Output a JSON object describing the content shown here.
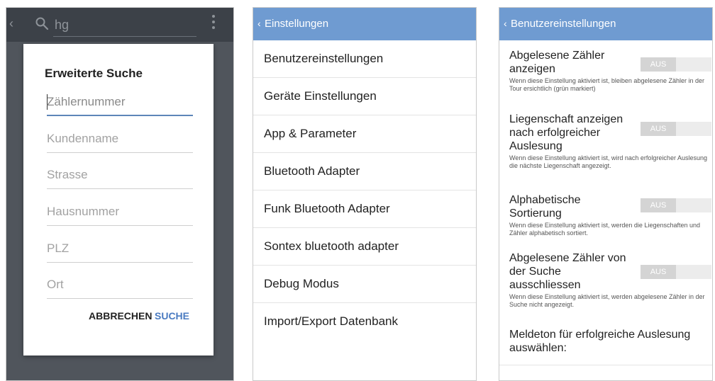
{
  "screen1": {
    "back_icon": "back-chevron-icon",
    "search_icon": "search-icon",
    "search_query": "hg",
    "overflow_icon": "overflow-menu-icon",
    "dialog": {
      "title": "Erweiterte Suche",
      "fields": [
        {
          "placeholder": "Zählernummer",
          "active": true
        },
        {
          "placeholder": "Kundenname"
        },
        {
          "placeholder": "Strasse"
        },
        {
          "placeholder": "Hausnummer"
        },
        {
          "placeholder": "PLZ"
        },
        {
          "placeholder": "Ort"
        }
      ],
      "cancel_label": "ABBRECHEN",
      "search_label": "SUCHE"
    }
  },
  "screen2": {
    "title": "Einstellungen",
    "items": [
      "Benutzereinstellungen",
      "Geräte Einstellungen",
      "App & Parameter",
      "Bluetooth Adapter",
      "Funk Bluetooth Adapter",
      "Sontex bluetooth adapter",
      "Debug Modus",
      "Import/Export Datenbank"
    ]
  },
  "screen3": {
    "title": "Benutzereinstellungen",
    "settings": [
      {
        "title": "Abgelesene Zähler anzeigen",
        "description": "Wenn diese Einstellung aktiviert ist, bleiben abgelesene Zähler in der Tour ersichtlich (grün markiert)",
        "toggle": "AUS"
      },
      {
        "title": "Liegenschaft anzeigen nach erfolgreicher Auslesung",
        "description": "Wenn diese Einstellung aktiviert ist, wird nach erfolgreicher Auslesung die nächste Liegenschaft angezeigt.",
        "toggle": "AUS"
      },
      {
        "title": "Alphabetische Sortierung",
        "description": "Wenn diese Einstellung aktiviert ist, werden die Liegenschaften und Zähler alphabetisch sortiert.",
        "toggle": "AUS"
      },
      {
        "title": "Abgelesene Zähler von der Suche ausschliessen",
        "description": "Wenn diese Einstellung aktiviert ist, werden abgelesene Zähler in der Suche nicht angezeigt.",
        "toggle": "AUS"
      }
    ],
    "last_setting": "Meldeton für erfolgreiche Auslesung auswählen:"
  },
  "colors": {
    "actionbar": "#6f9bd1",
    "accent_blue": "#4a7bc1",
    "dark_toolbar": "#3c4148"
  }
}
